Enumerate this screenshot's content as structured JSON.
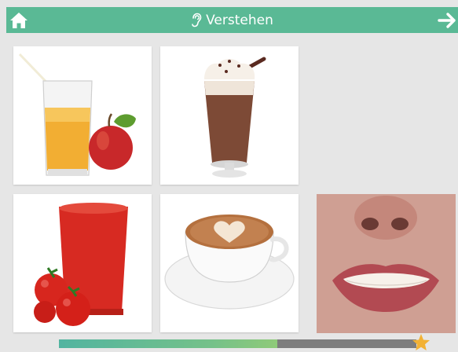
{
  "header": {
    "title": "Verstehen",
    "home_icon": "home-icon",
    "ear_icon": "ear-icon",
    "next_icon": "arrow-right-icon"
  },
  "choices": [
    {
      "name": "apfelsaft",
      "icon": "apple-juice-image"
    },
    {
      "name": "schokoshake",
      "icon": "chocolate-milkshake-image"
    },
    {
      "name": "tomatensaft",
      "icon": "tomato-juice-image"
    },
    {
      "name": "kaffee",
      "icon": "cappuccino-image"
    }
  ],
  "speaker": {
    "icon": "speaker-mouth-video"
  },
  "progress": {
    "value": 0.61,
    "reward_icon": "star-icon"
  },
  "colors": {
    "header": "#5ab995",
    "background": "#e6e6e6",
    "progress_fill": "#75c189",
    "progress_track": "#7d7d7d",
    "star": "#f2b134"
  }
}
